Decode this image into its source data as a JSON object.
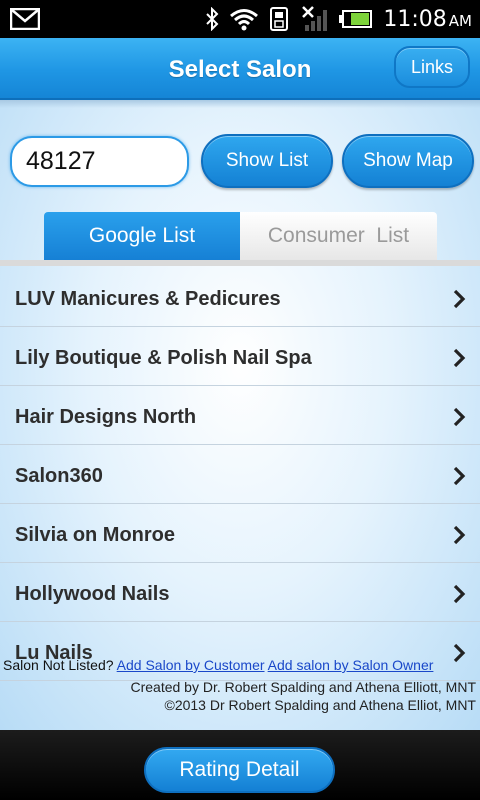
{
  "status_bar": {
    "time": "11:08",
    "ampm": "AM",
    "icons": [
      "gmail-icon",
      "bluetooth-icon",
      "wifi-icon",
      "sd-card-icon",
      "signal-icon",
      "battery-icon"
    ]
  },
  "header": {
    "title": "Select Salon",
    "links_label": "Links"
  },
  "search": {
    "zip_value": "48127",
    "show_list_label": "Show List",
    "show_map_label": "Show Map"
  },
  "tabs": [
    {
      "label": "Google List",
      "active": true
    },
    {
      "label": "Consumer  List",
      "active": false
    }
  ],
  "salons": [
    {
      "name": "LUV Manicures & Pedicures"
    },
    {
      "name": "Lily Boutique & Polish Nail Spa"
    },
    {
      "name": "Hair Designs North"
    },
    {
      "name": "Salon360"
    },
    {
      "name": "Silvia on Monroe"
    },
    {
      "name": "Hollywood Nails"
    },
    {
      "name": "Lu Nails"
    }
  ],
  "footer": {
    "not_listed": "Salon Not Listed?",
    "add_by_customer": "Add Salon by Customer",
    "add_by_owner": "Add salon by Salon Owner",
    "credit_line1": "Created by Dr. Robert Spalding and Athena Elliott, MNT",
    "credit_line2": "©2013 Dr Robert Spalding and Athena Elliot, MNT"
  },
  "bottom": {
    "rating_detail_label": "Rating Detail"
  },
  "colors": {
    "accent_blue": "#1f96e4",
    "link_blue": "#1a48c9"
  }
}
